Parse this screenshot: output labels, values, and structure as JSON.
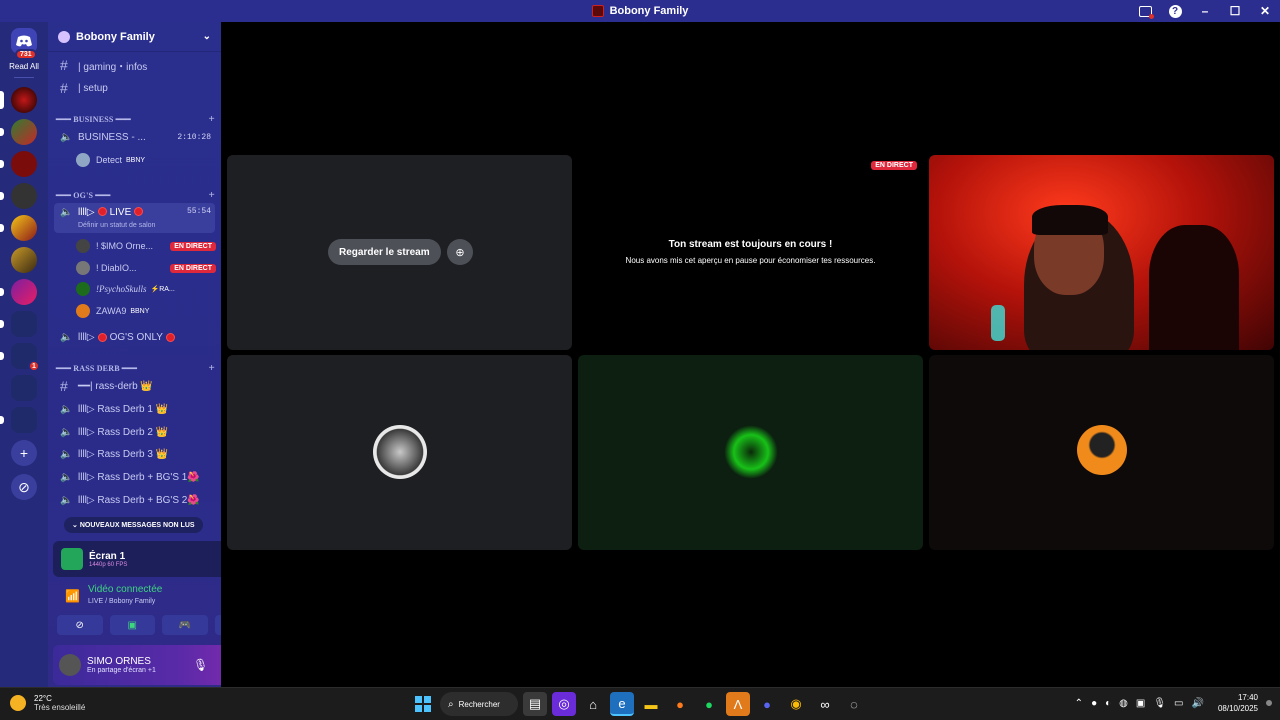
{
  "window": {
    "title": "Bobony Family"
  },
  "rail": {
    "inbox_count": "731",
    "read_all": "Read All",
    "server_badge": "1"
  },
  "guild": {
    "name": "Bobony Family"
  },
  "channels": {
    "gaming": "| gaming・infos",
    "setup": "| setup",
    "cat_business": "━━━ BUSINESS ━━━",
    "business_voice": "BUSINESS - ...",
    "business_timer": "2:10:28",
    "detect_user": "Detect",
    "detect_tag": "BBNY",
    "cat_ogs": "━━━ OG'S ━━━",
    "live_voice_prefix": "llll▷",
    "live_voice_label": "LIVE",
    "live_timer": "55:54",
    "live_subtitle": "Définir un statut de salon",
    "u1": "! $IMO Orne...",
    "u2": "! DiabIO...",
    "u3": "!PsychoSkulls",
    "u3_tag": "⚡RA...",
    "u4": "ZAWA9",
    "u4_tag": "BBNY",
    "live_badge": "EN DIRECT",
    "ogs_only": "OG'S ONLY",
    "cat_rass": "━━━ RASS DERB ━━━",
    "rass_text": "━━| rass-derb 👑",
    "rass1": "llll▷ Rass Derb 1 👑",
    "rass2": "llll▷ Rass Derb 2 👑",
    "rass3": "llll▷ Rass Derb 3 👑",
    "rassbg1": "llll▷ Rass Derb + BG'S 1🌺",
    "rassbg2": "llll▷ Rass Derb + BG'S 2🌺",
    "new_messages": "NOUVEAUX MESSAGES NON LUS"
  },
  "screen_share": {
    "title": "Écran 1",
    "quality": "1440p 60 FPS"
  },
  "voice": {
    "status": "Vidéo connectée",
    "channel": "LIVE / Bobony Family"
  },
  "user": {
    "name": "SIMO ORNES",
    "status": "En partage d'écran +1"
  },
  "stage": {
    "watch_button": "Regarder le stream",
    "live_badge": "EN DIRECT",
    "paused_title": "Ton stream est toujours en cours !",
    "paused_sub": "Nous avons mis cet aperçu en pause pour économiser tes ressources."
  },
  "taskbar": {
    "temp": "22°C",
    "weather": "Très ensoleillé",
    "search": "Rechercher",
    "time": "17:40",
    "date": "08/10/2025"
  },
  "colors": {
    "accent": "#2b2d8f",
    "live": "#e0283c",
    "connected": "#3ed57f"
  }
}
